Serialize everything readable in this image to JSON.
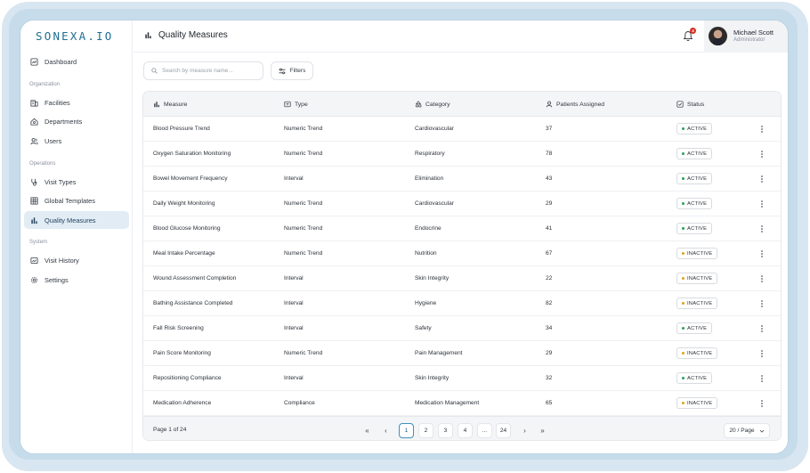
{
  "app": {
    "logo": "SONEXA.IO"
  },
  "sidebar": {
    "items_top": [
      {
        "label": "Dashboard",
        "icon": "dashboard-icon"
      }
    ],
    "sections": [
      {
        "title": "Organization",
        "items": [
          {
            "label": "Facilities",
            "icon": "building-icon"
          },
          {
            "label": "Departments",
            "icon": "department-icon"
          },
          {
            "label": "Users",
            "icon": "users-icon"
          }
        ]
      },
      {
        "title": "Operations",
        "items": [
          {
            "label": "Visit Types",
            "icon": "stethoscope-icon"
          },
          {
            "label": "Global Templates",
            "icon": "grid-icon"
          },
          {
            "label": "Quality Measures",
            "icon": "bar-chart-icon",
            "active": true
          }
        ]
      },
      {
        "title": "System",
        "items": [
          {
            "label": "Visit History",
            "icon": "history-icon"
          },
          {
            "label": "Settings",
            "icon": "gear-icon"
          }
        ]
      }
    ]
  },
  "header": {
    "title": "Quality Measures",
    "notifications_count": "4",
    "user_name": "Michael Scott",
    "user_role": "Administrator"
  },
  "toolbar": {
    "search_placeholder": "Search by measure name...",
    "filters_label": "Filters"
  },
  "table": {
    "columns": [
      "Measure",
      "Type",
      "Category",
      "Patients Assigned",
      "Status"
    ],
    "rows": [
      {
        "measure": "Blood Pressure Trend",
        "type": "Numeric Trend",
        "category": "Cardiovascular",
        "patients": "37",
        "status": "ACTIVE"
      },
      {
        "measure": "Oxygen Saturation Monitoring",
        "type": "Numeric Trend",
        "category": "Respiratory",
        "patients": "78",
        "status": "ACTIVE"
      },
      {
        "measure": "Bowel Movement Frequency",
        "type": "Interval",
        "category": "Elimination",
        "patients": "43",
        "status": "ACTIVE"
      },
      {
        "measure": "Daily Weight Monitoring",
        "type": "Numeric Trend",
        "category": "Cardiovascular",
        "patients": "29",
        "status": "ACTIVE"
      },
      {
        "measure": "Blood Glucose Monitoring",
        "type": "Numeric Trend",
        "category": "Endocrine",
        "patients": "41",
        "status": "ACTIVE"
      },
      {
        "measure": "Meal Intake Percentage",
        "type": "Numeric Trend",
        "category": "Nutrition",
        "patients": "67",
        "status": "INACTIVE"
      },
      {
        "measure": "Wound Assessment Completion",
        "type": "Interval",
        "category": "Skin Integrity",
        "patients": "22",
        "status": "INACTIVE"
      },
      {
        "measure": "Bathing Assistance Completed",
        "type": "Interval",
        "category": "Hygiene",
        "patients": "82",
        "status": "INACTIVE"
      },
      {
        "measure": "Fall Risk Screening",
        "type": "Interval",
        "category": "Safety",
        "patients": "34",
        "status": "ACTIVE"
      },
      {
        "measure": "Pain Score Monitoring",
        "type": "Numeric Trend",
        "category": "Pain Management",
        "patients": "29",
        "status": "INACTIVE"
      },
      {
        "measure": "Repositioning Compliance",
        "type": "Interval",
        "category": "Skin Integrity",
        "patients": "32",
        "status": "ACTIVE"
      },
      {
        "measure": "Medication Adherence",
        "type": "Compliance",
        "category": "Medication Management",
        "patients": "65",
        "status": "INACTIVE"
      }
    ]
  },
  "status_colors": {
    "ACTIVE": "#2e9e5b",
    "INACTIVE": "#e3a21a"
  },
  "pagination": {
    "info": "Page 1 of 24",
    "first": "«",
    "prev": "‹",
    "pages": [
      "1",
      "2",
      "3",
      "4",
      "...",
      "24"
    ],
    "current": "1",
    "next": "›",
    "last": "»",
    "per_page": "20 / Page"
  }
}
